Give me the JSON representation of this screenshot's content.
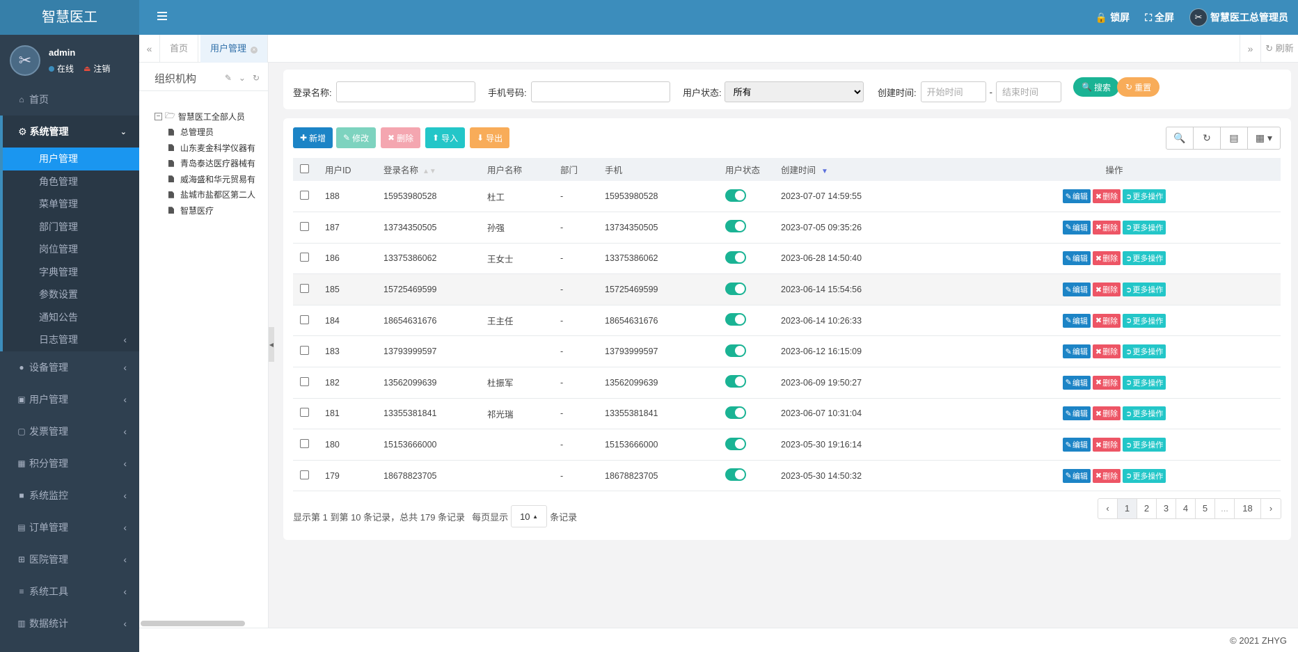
{
  "header": {
    "brand": "智慧医工",
    "lock_label": "锁屏",
    "fullscreen_label": "全屏",
    "admin_label": "智慧医工总管理员"
  },
  "user": {
    "name": "admin",
    "status": "在线",
    "logout": "注销"
  },
  "sidebar": {
    "home": "首页",
    "system": "系统管理",
    "system_items": [
      "用户管理",
      "角色管理",
      "菜单管理",
      "部门管理",
      "岗位管理",
      "字典管理",
      "参数设置",
      "通知公告",
      "日志管理"
    ],
    "menus": [
      "设备管理",
      "用户管理",
      "发票管理",
      "积分管理",
      "系统监控",
      "订单管理",
      "医院管理",
      "系统工具",
      "数据统计"
    ]
  },
  "tabs": {
    "home": "首页",
    "active": "用户管理",
    "refresh": "刷新"
  },
  "tree": {
    "title": "组织机构",
    "root": "智慧医工全部人员",
    "children": [
      "总管理员",
      "山东麦金科学仪器有",
      "青岛泰达医疗器械有",
      "威海盛和华元贸易有",
      "盐城市盐都区第二人",
      "智慧医疗"
    ]
  },
  "search": {
    "login_label": "登录名称:",
    "phone_label": "手机号码:",
    "status_label": "用户状态:",
    "status_value": "所有",
    "time_label": "创建时间:",
    "start_placeholder": "开始时间",
    "end_placeholder": "结束时间",
    "dash": "-",
    "search_btn": "搜索",
    "reset_btn": "重置"
  },
  "toolbar": {
    "add": "新增",
    "edit": "修改",
    "delete": "删除",
    "import": "导入",
    "export": "导出"
  },
  "table": {
    "headers": [
      "用户ID",
      "登录名称",
      "用户名称",
      "部门",
      "手机",
      "用户状态",
      "创建时间",
      "操作"
    ],
    "rows": [
      {
        "id": "188",
        "login": "15953980528",
        "name": "杜工",
        "dept": "-",
        "phone": "15953980528",
        "created": "2023-07-07 14:59:55"
      },
      {
        "id": "187",
        "login": "13734350505",
        "name": "孙强",
        "dept": "-",
        "phone": "13734350505",
        "created": "2023-07-05 09:35:26"
      },
      {
        "id": "186",
        "login": "13375386062",
        "name": "王女士",
        "dept": "-",
        "phone": "13375386062",
        "created": "2023-06-28 14:50:40"
      },
      {
        "id": "185",
        "login": "15725469599",
        "name": "",
        "dept": "-",
        "phone": "15725469599",
        "created": "2023-06-14 15:54:56"
      },
      {
        "id": "184",
        "login": "18654631676",
        "name": "王主任",
        "dept": "-",
        "phone": "18654631676",
        "created": "2023-06-14 10:26:33"
      },
      {
        "id": "183",
        "login": "13793999597",
        "name": "",
        "dept": "-",
        "phone": "13793999597",
        "created": "2023-06-12 16:15:09"
      },
      {
        "id": "182",
        "login": "13562099639",
        "name": "杜振军",
        "dept": "-",
        "phone": "13562099639",
        "created": "2023-06-09 19:50:27"
      },
      {
        "id": "181",
        "login": "13355381841",
        "name": "祁光瑞",
        "dept": "-",
        "phone": "13355381841",
        "created": "2023-06-07 10:31:04"
      },
      {
        "id": "180",
        "login": "15153666000",
        "name": "",
        "dept": "-",
        "phone": "15153666000",
        "created": "2023-05-30 19:16:14"
      },
      {
        "id": "179",
        "login": "18678823705",
        "name": "",
        "dept": "-",
        "phone": "18678823705",
        "created": "2023-05-30 14:50:32"
      }
    ],
    "row_actions": {
      "edit": "编辑",
      "delete": "删除",
      "more": "更多操作"
    }
  },
  "pagination": {
    "info": "显示第 1 到第 10 条记录，总共 179 条记录",
    "per_page_prefix": "每页显示",
    "per_page": "10",
    "per_page_suffix": "条记录",
    "pages": [
      "‹",
      "1",
      "2",
      "3",
      "4",
      "5",
      "...",
      "18",
      "›"
    ]
  },
  "footer": "© 2021 ZHYG"
}
